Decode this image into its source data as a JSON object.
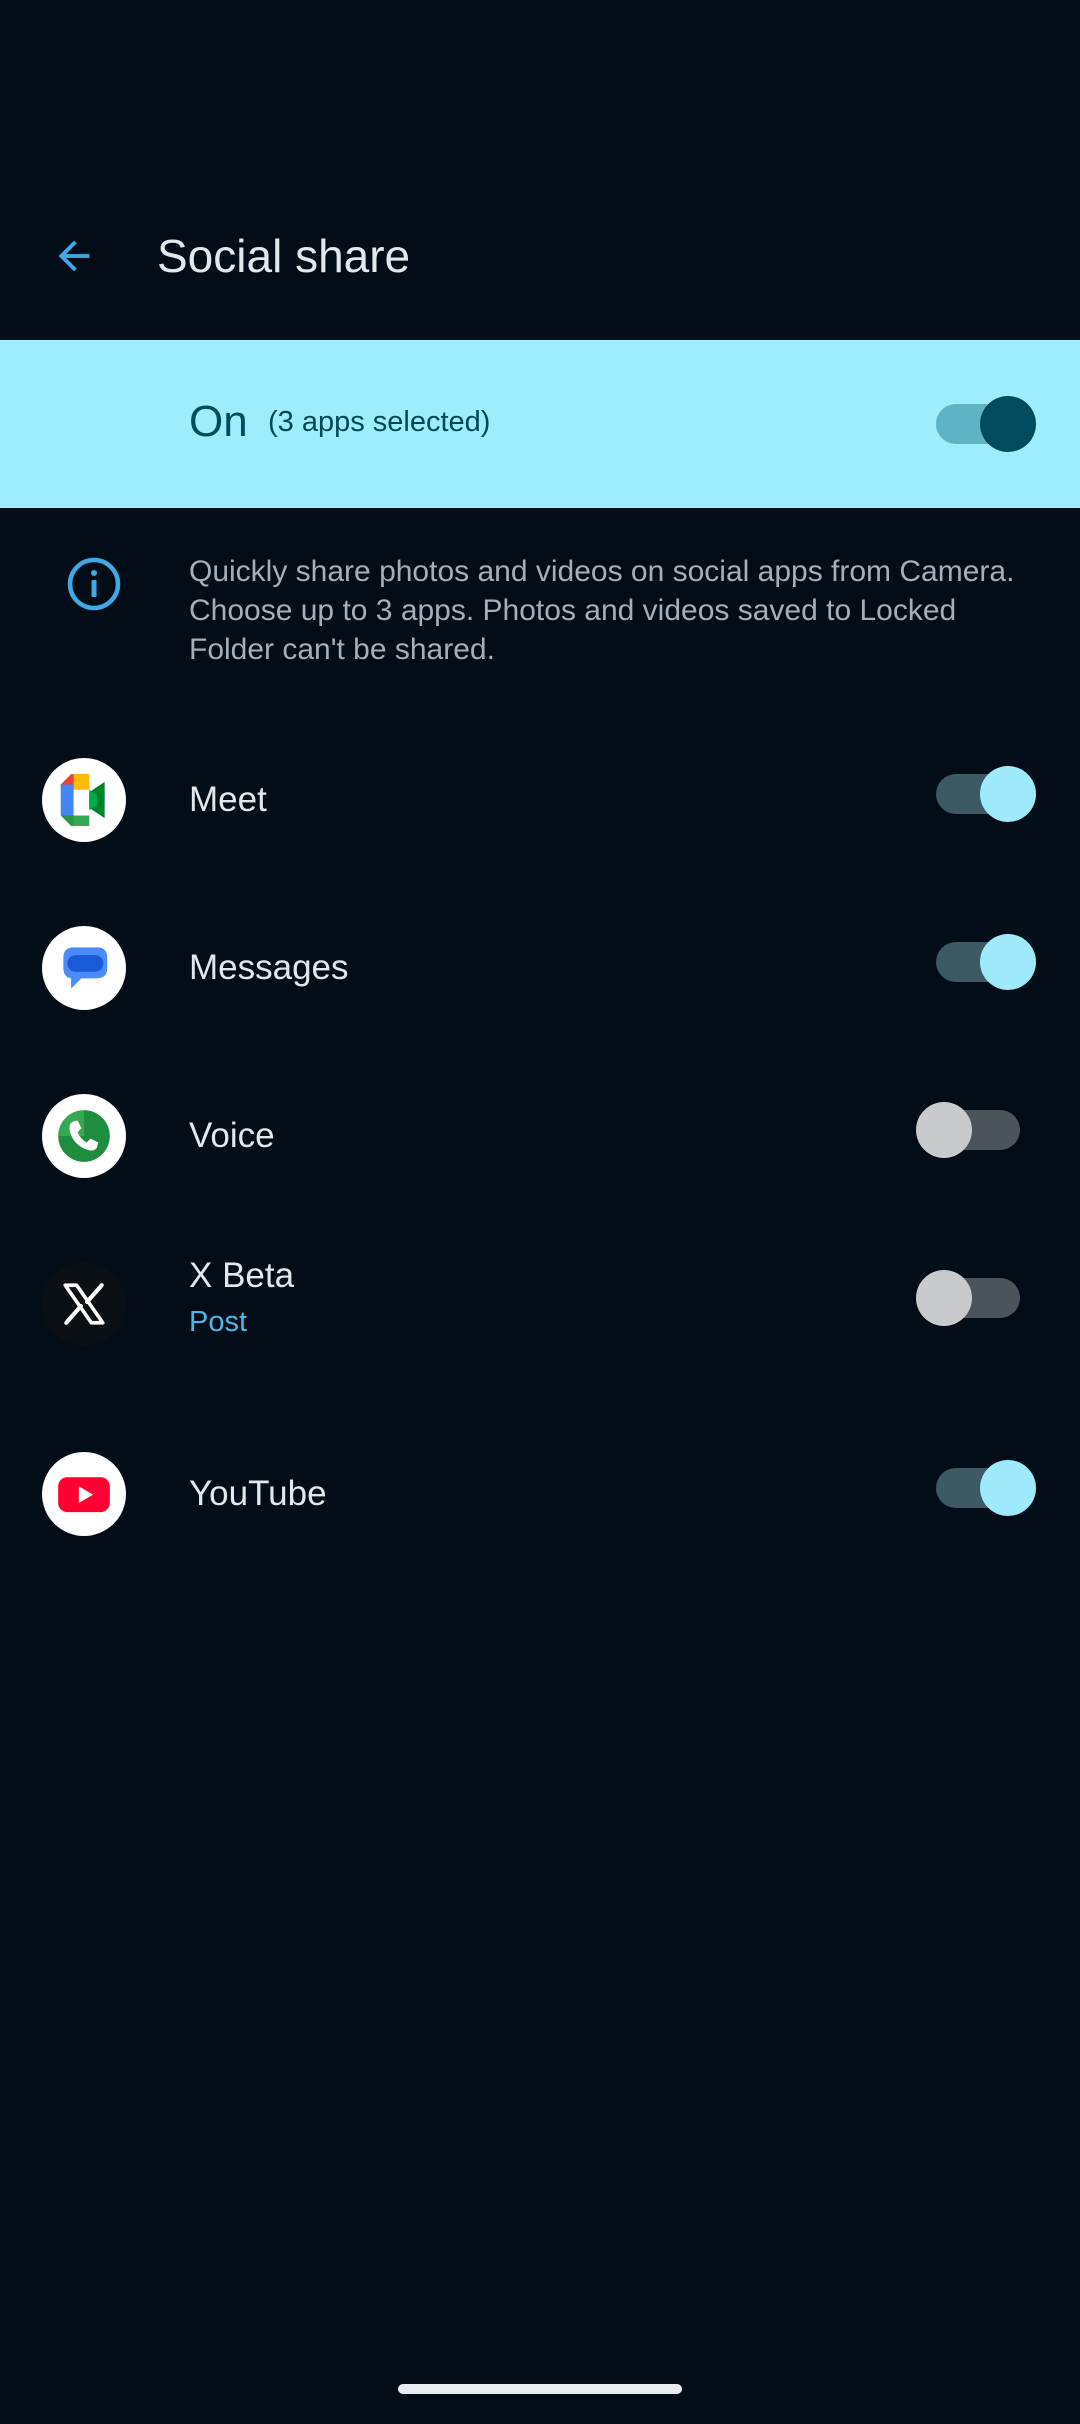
{
  "header": {
    "title": "Social share",
    "back_icon": "arrow-left-icon"
  },
  "master": {
    "state_label": "On",
    "count_label": "(3 apps selected)",
    "enabled": true
  },
  "info": {
    "icon": "info-icon",
    "text": "Quickly share photos and videos on social apps from Camera. Choose up to 3 apps. Photos and videos saved to Locked Folder can't be shared."
  },
  "apps": [
    {
      "name": "Meet",
      "subtitle": "",
      "icon": "google-meet-icon",
      "enabled": true
    },
    {
      "name": "Messages",
      "subtitle": "",
      "icon": "google-messages-icon",
      "enabled": true
    },
    {
      "name": "Voice",
      "subtitle": "",
      "icon": "google-voice-icon",
      "enabled": false
    },
    {
      "name": "X Beta",
      "subtitle": "Post",
      "icon": "x-icon",
      "enabled": false
    },
    {
      "name": "YouTube",
      "subtitle": "",
      "icon": "youtube-icon",
      "enabled": true
    }
  ],
  "colors": {
    "background": "#020D17",
    "accent": "#9EEDFC",
    "link": "#4FB7E3"
  }
}
